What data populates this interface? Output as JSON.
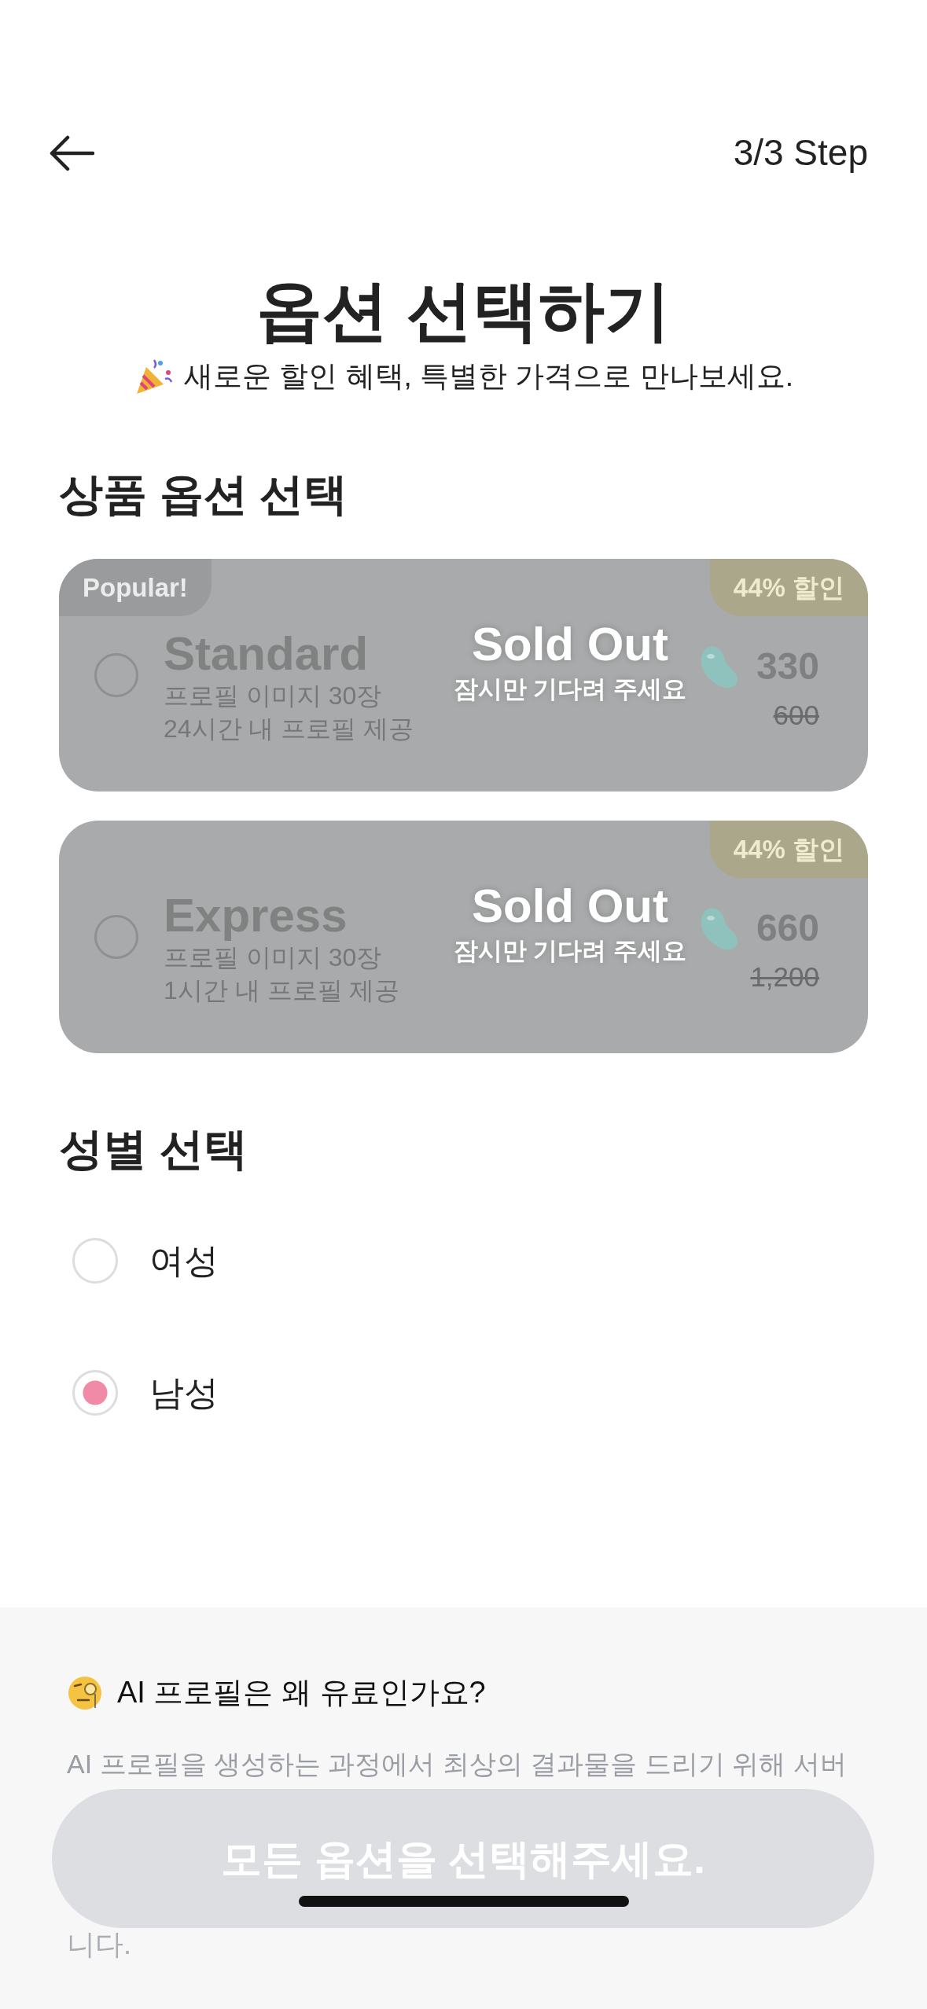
{
  "header": {
    "step": "3/3 Step"
  },
  "title": "옵션 선택하기",
  "subtitle": "새로운 할인 혜택, 특별한 가격으로 만나보세요.",
  "product_section": {
    "heading": "상품 옵션 선택",
    "options": [
      {
        "badge": "Popular!",
        "discount": "44% 할인",
        "name": "Standard",
        "lines": [
          "프로필 이미지 30장",
          "24시간 내 프로필 제공"
        ],
        "price": "330",
        "original_price": "600",
        "selected": false,
        "sold_out": true,
        "overlay_title": "Sold Out",
        "overlay_subtitle": "잠시만 기다려 주세요"
      },
      {
        "discount": "44% 할인",
        "name": "Express",
        "lines": [
          "프로필 이미지 30장",
          "1시간 내 프로필 제공"
        ],
        "price": "660",
        "original_price": "1,200",
        "selected": false,
        "sold_out": true,
        "overlay_title": "Sold Out",
        "overlay_subtitle": "잠시만 기다려 주세요"
      }
    ]
  },
  "gender_section": {
    "heading": "성별 선택",
    "options": [
      {
        "label": "여성",
        "selected": false
      },
      {
        "label": "남성",
        "selected": true
      }
    ]
  },
  "info": {
    "title": "AI 프로필은 왜 유료인가요?",
    "lines": [
      "AI 프로필을 생성하는 과정에서 최상의 결과물을 드리기 위해 서버",
      "니다."
    ]
  },
  "cta": {
    "label": "모든 옵션을 선택해주세요.",
    "disabled": true
  }
}
